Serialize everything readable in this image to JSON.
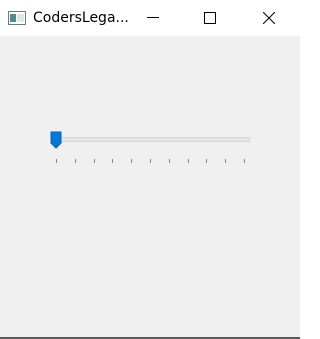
{
  "window": {
    "title": "CodersLega...",
    "controls": {
      "minimize_icon": "minimize-icon",
      "maximize_icon": "maximize-icon",
      "close_icon": "close-icon"
    }
  },
  "slider": {
    "value_fraction": 0.0,
    "tick_count": 11,
    "accent_color": "#0078d7"
  }
}
